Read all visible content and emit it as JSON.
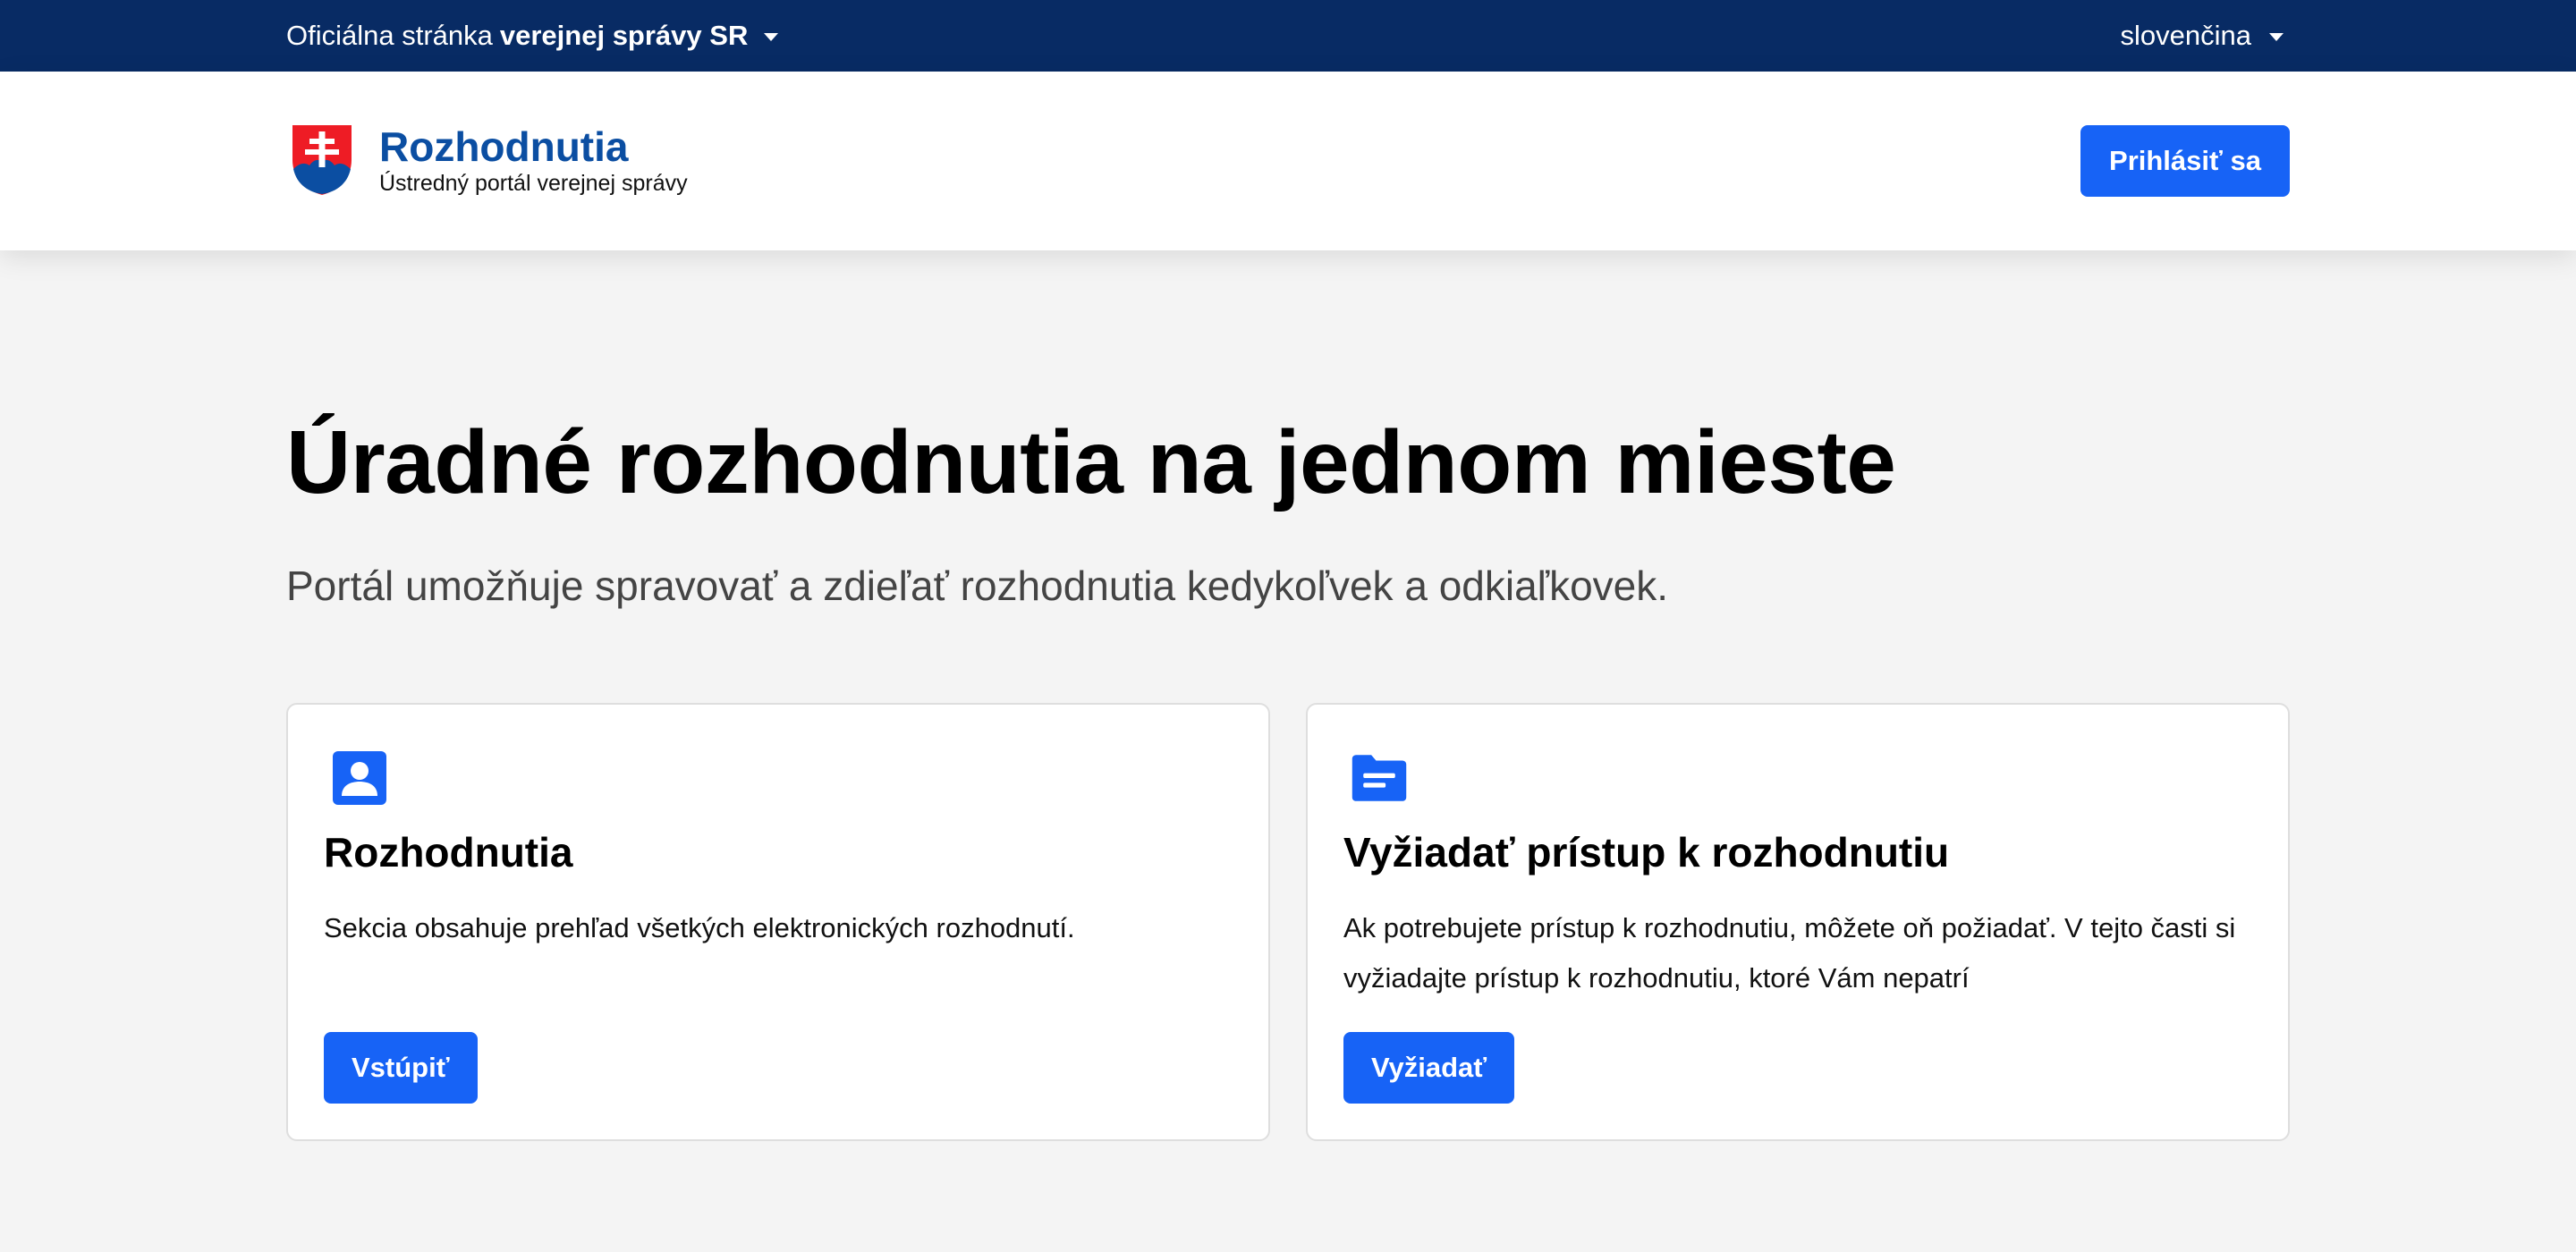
{
  "gov_bar": {
    "official_prefix": "Oficiálna stránka",
    "official_bold": "verejnej správy SR",
    "language": "slovenčina"
  },
  "header": {
    "brand_name": "Rozhodnutia",
    "brand_subtitle": "Ústredný portál verejnej správy",
    "login_label": "Prihlásiť sa"
  },
  "hero": {
    "title": "Úradné rozhodnutia na jednom mieste",
    "subtitle": "Portál umožňuje spravovať a zdieľať rozhodnutia kedykoľvek a odkiaľkovek."
  },
  "cards": [
    {
      "icon": "person-badge-icon",
      "title": "Rozhodnutia",
      "description": "Sekcia obsahuje prehľad všetkých elektronických rozhodnutí.",
      "button_label": "Vstúpiť"
    },
    {
      "icon": "folder-document-icon",
      "title": "Vyžiadať prístup k rozhodnutiu",
      "description": "Ak potrebujete prístup k rozhodnutiu, môžete oň požiadať. V tejto časti si vyžiadajte prístup k rozhodnutiu, ktoré Vám nepatrí",
      "button_label": "Vyžiadať"
    }
  ],
  "colors": {
    "gov_bar": "#082b64",
    "brand": "#0b4ea2",
    "primary_button": "#1763f6",
    "page_background": "#f4f4f4"
  }
}
